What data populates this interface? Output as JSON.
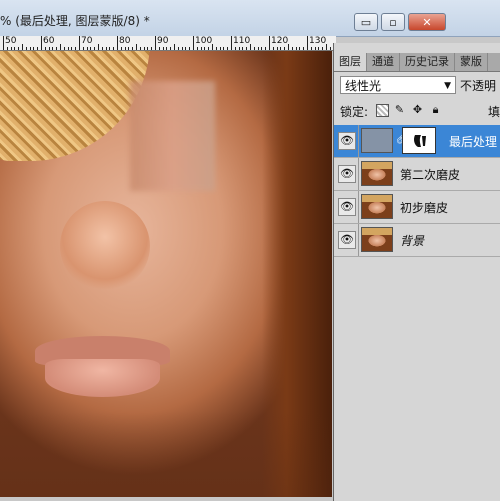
{
  "document": {
    "title": "% (最后处理, 图层蒙版/8) *",
    "window_buttons": {
      "minimize": "▭",
      "restore": "▫",
      "close": "✕"
    }
  },
  "ruler": {
    "labels": [
      "50",
      "60",
      "70",
      "80",
      "90",
      "100",
      "110",
      "120",
      "130"
    ]
  },
  "panel": {
    "tabs": [
      {
        "label": "图层",
        "active": true
      },
      {
        "label": "通道",
        "active": false
      },
      {
        "label": "历史记录",
        "active": false
      },
      {
        "label": "蒙版",
        "active": false
      }
    ],
    "blend_mode": "线性光",
    "opacity_label": "不透明",
    "lock_label": "锁定:",
    "fill_label": "填",
    "layers": [
      {
        "name": "最后处理",
        "selected": true,
        "thumb": "gray",
        "has_mask": true,
        "visible": true
      },
      {
        "name": "第二次磨皮",
        "selected": false,
        "thumb": "photo",
        "visible": true
      },
      {
        "name": "初步磨皮",
        "selected": false,
        "thumb": "photo",
        "visible": true
      },
      {
        "name": "背景",
        "selected": false,
        "thumb": "photo",
        "visible": true,
        "italic": true
      }
    ]
  },
  "colors": {
    "selected_layer": "#3b86d6",
    "panel_bg": "#d6d6d6",
    "close_button": "#c8472c"
  }
}
